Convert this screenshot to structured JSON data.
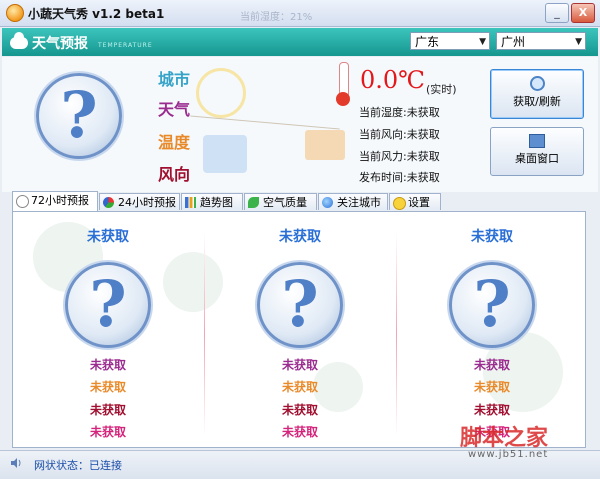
{
  "window": {
    "title": "小蔬天气秀  v1.2 beta1",
    "ghost_text": "当前湿度：21%",
    "minimize": "_",
    "close": "X"
  },
  "header": {
    "title": "天气预报",
    "subtitle": "TEMPERATURE",
    "province": "广东",
    "city": "广州"
  },
  "summary": {
    "labels": {
      "city": "城市",
      "weather": "天气",
      "temp": "温度",
      "wind": "风向"
    },
    "temperature": "0.0℃",
    "temperature_note": "(实时)",
    "humidity": "当前湿度:未获取",
    "wind_direction": "当前风向:未获取",
    "wind_power": "当前风力:未获取",
    "publish_time": "发布时间:未获取",
    "refresh_button": "获取/刷新",
    "desktop_button": "桌面窗口"
  },
  "tabs": [
    {
      "label": "72小时预报",
      "active": true,
      "icon": "clock-icon"
    },
    {
      "label": "24小时预报",
      "active": false,
      "icon": "pie-icon"
    },
    {
      "label": "趋势图",
      "active": false,
      "icon": "bar-chart-icon"
    },
    {
      "label": "空气质量",
      "active": false,
      "icon": "leaf-icon"
    },
    {
      "label": "关注城市",
      "active": false,
      "icon": "globe-icon"
    },
    {
      "label": "设置",
      "active": false,
      "icon": "smile-icon"
    }
  ],
  "forecast": [
    {
      "title": "未获取",
      "line1": "未获取",
      "line2": "未获取",
      "line3": "未获取",
      "line4": "未获取"
    },
    {
      "title": "未获取",
      "line1": "未获取",
      "line2": "未获取",
      "line3": "未获取",
      "line4": "未获取"
    },
    {
      "title": "未获取",
      "line1": "未获取",
      "line2": "未获取",
      "line3": "未获取",
      "line4": "未获取"
    }
  ],
  "status": {
    "text": "网状状态：已连接"
  },
  "watermark": {
    "text": "脚本之家",
    "url": "www.jb51.net"
  },
  "colors": {
    "header": "#15968f",
    "temp": "#e4171b",
    "forecast_title": "#2a6fd6"
  }
}
